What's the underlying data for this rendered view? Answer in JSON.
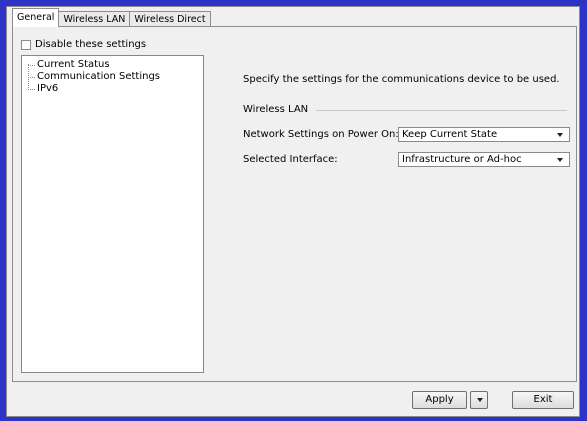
{
  "tabs": [
    {
      "label": "General",
      "active": true
    },
    {
      "label": "Wireless LAN",
      "active": false
    },
    {
      "label": "Wireless Direct",
      "active": false
    }
  ],
  "disable_checkbox": {
    "label": "Disable these settings",
    "checked": false
  },
  "tree": {
    "items": [
      "Current Status",
      "Communication Settings",
      "IPv6"
    ],
    "selected": "Communication Settings"
  },
  "content": {
    "description": "Specify the settings for the communications device to be used.",
    "group_label": "Wireless LAN",
    "network_settings": {
      "label": "Network Settings on Power On:",
      "value": "Keep Current State"
    },
    "selected_interface": {
      "label": "Selected Interface:",
      "value": "Infrastructure or Ad-hoc"
    }
  },
  "buttons": {
    "apply": "Apply",
    "exit": "Exit"
  },
  "colors": {
    "background": "#2d33c7",
    "window": "#f0f0f0"
  }
}
